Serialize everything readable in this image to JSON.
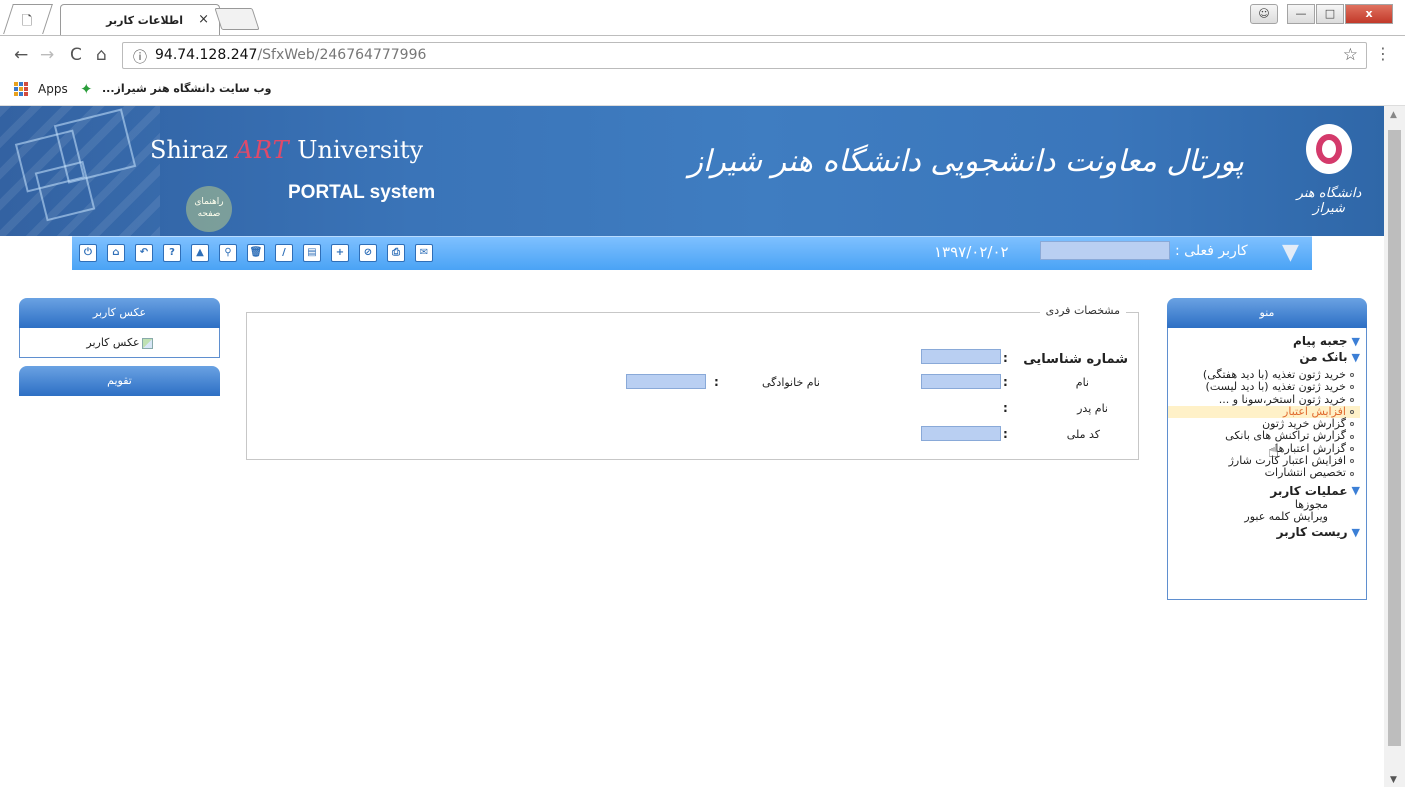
{
  "browser": {
    "tab_title": "اطلاعات کاربر",
    "tab_close": "×",
    "url_host": "94.74.128.247",
    "url_path": "/SfxWeb/246764777996",
    "bookmarks": {
      "apps_label": "Apps",
      "site_label": "وب سایت دانشگاه هنر شیراز..."
    },
    "icons": {
      "doc": "page-icon",
      "back": "←",
      "forward": "→",
      "reload": "C",
      "home": "⌂",
      "info": "ⓘ",
      "star": "☆",
      "menu": "⋮",
      "minimize": "▭",
      "maximize": "▢",
      "close": "x",
      "user": "👤"
    }
  },
  "banner": {
    "brand_prefix": "Shiraz",
    "brand_art": "ART",
    "brand_suffix": "University",
    "portal_system": "PORTAL system",
    "help_label": "راهنمای صفحه",
    "portal_title": "پورتال معاونت دانشجویی دانشگاه هنر شیراز",
    "logo_text": "دانشگاه هنر شیراز"
  },
  "iconbar": {
    "icons": [
      "power-icon",
      "home-icon",
      "back-icon",
      "help-icon",
      "warning-icon",
      "search-icon",
      "delete-icon",
      "edit-icon",
      "save-icon",
      "add-icon",
      "cancel-icon",
      "print-icon",
      "mail-icon"
    ],
    "glyphs": [
      "⏻",
      "⌂",
      "↶",
      "?",
      "▲",
      "⚲",
      "🗑",
      "/",
      "▤",
      "+",
      "⊘",
      "⎙",
      "✉"
    ],
    "date": "۱۳۹۷/۰۲/۰۲",
    "current_user_label": "کاربر فعلی :"
  },
  "left_panel": {
    "photo_title": "عکس کاربر",
    "photo_alt": "عکس کاربر",
    "calendar_title": "تقویم"
  },
  "form": {
    "legend": "مشخصات فردی",
    "fields": {
      "id_label": "شماره شناسایی",
      "name_label": "نام",
      "family_label": "نام خانوادگی",
      "father_label": "نام پدر",
      "national_label": "کد ملی",
      "colon": ":"
    }
  },
  "menu": {
    "title": "منو",
    "sections": {
      "inbox": "جعبه پیام",
      "mybank": "بانک من",
      "user_ops": "عملیات کاربر",
      "reset_user": "ریست کاربر"
    },
    "bank_items": [
      "خرید ژتون تغذیه (با دید هفتگی)",
      "خرید ژتون تغذیه (با دید لیست)",
      "خرید ژتون استخر،سونا و ...",
      "افزایش اعتبار",
      "گزارش خرید ژتون",
      "گزارش تراکنش های بانکی",
      "گزارش اعتبارها",
      "افزایش اعتبار کارت شارژ",
      "تخصیص انتشارات"
    ],
    "user_items": [
      "مجوزها",
      "ویرایش کلمه عبور"
    ]
  }
}
